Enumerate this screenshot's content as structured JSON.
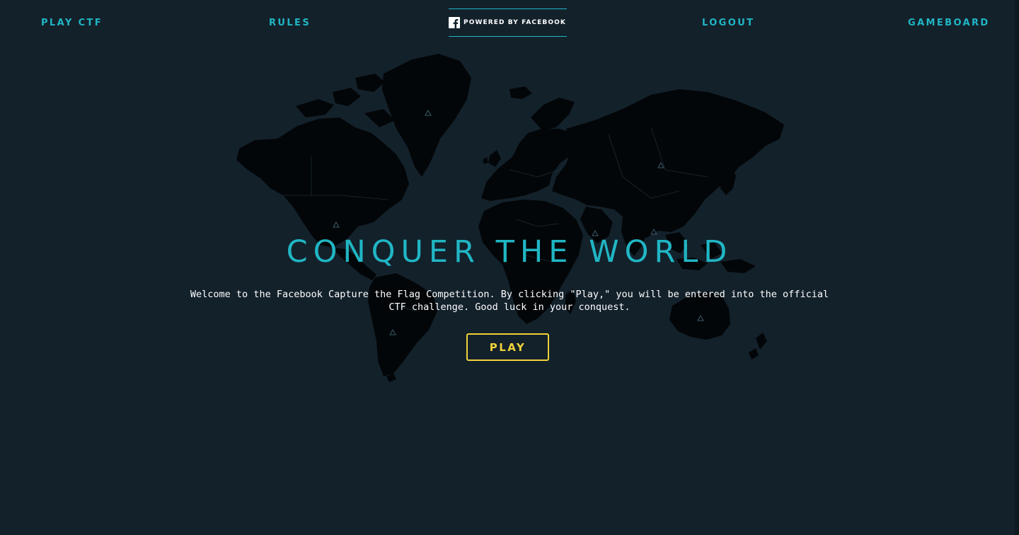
{
  "nav": {
    "play_ctf": "PLAY CTF",
    "rules": "RULES",
    "powered_by": "POWERED BY FACEBOOK",
    "logout": "LOGOUT",
    "gameboard": "GAMEBOARD"
  },
  "hero": {
    "title": "CONQUER THE WORLD",
    "welcome": "Welcome to the Facebook Capture the Flag Competition. By clicking \"Play,\" you will be entered into the official CTF challenge. Good luck in your conquest.",
    "play_label": "PLAY"
  },
  "icons": {
    "brand": "facebook-icon",
    "map": "world-map-icon",
    "marker": "triangle-marker-icon"
  },
  "colors": {
    "background": "#13212b",
    "accent": "#20b6c4",
    "button": "#f1d23a",
    "map_land": "#030608"
  }
}
